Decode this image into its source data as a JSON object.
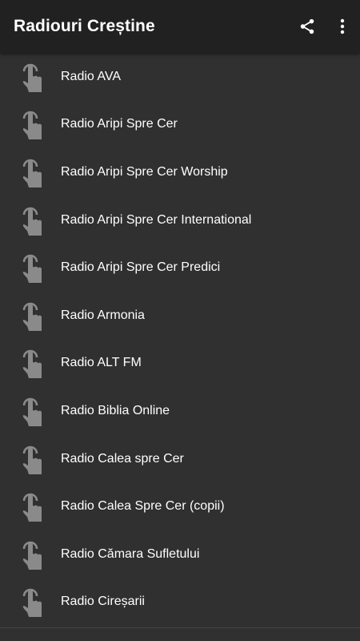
{
  "app_bar": {
    "title": "Radiouri Creștine",
    "share_icon": "share-icon",
    "menu_icon": "more-vert-icon"
  },
  "colors": {
    "app_bar_bg": "#212121",
    "list_bg": "#303030",
    "text": "#ffffff",
    "icon": "#8a8a8a"
  },
  "stations": [
    {
      "label": "Radio AVA",
      "icon": "touch-icon"
    },
    {
      "label": "Radio Aripi Spre Cer",
      "icon": "touch-icon"
    },
    {
      "label": "Radio Aripi Spre Cer Worship",
      "icon": "touch-icon"
    },
    {
      "label": "Radio Aripi Spre Cer International",
      "icon": "touch-icon"
    },
    {
      "label": "Radio Aripi Spre Cer Predici",
      "icon": "touch-icon"
    },
    {
      "label": "Radio Armonia",
      "icon": "touch-icon"
    },
    {
      "label": "Radio ALT FM",
      "icon": "touch-icon"
    },
    {
      "label": "Radio Biblia Online",
      "icon": "touch-icon"
    },
    {
      "label": "Radio Calea spre Cer",
      "icon": "touch-icon"
    },
    {
      "label": "Radio Calea Spre Cer (copii)",
      "icon": "touch-icon"
    },
    {
      "label": "Radio Cămara Sufletului",
      "icon": "touch-icon"
    },
    {
      "label": "Radio Cireșarii",
      "icon": "touch-icon"
    }
  ]
}
